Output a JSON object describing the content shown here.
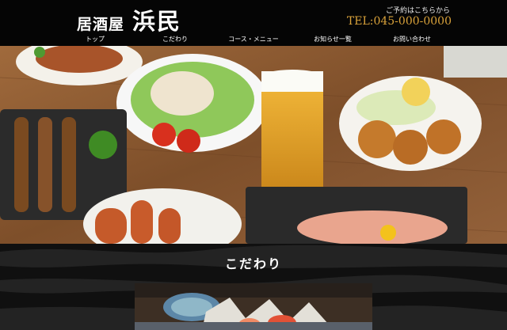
{
  "header": {
    "logo_small": "居酒屋",
    "logo_large": "浜民",
    "reservation_label": "ご予約はこちらから",
    "tel": "TEL:045-000-0000"
  },
  "nav": {
    "items": [
      {
        "label": "トップ"
      },
      {
        "label": "こだわり"
      },
      {
        "label": "コース・メニュー"
      },
      {
        "label": "お知らせ一覧"
      },
      {
        "label": "お問い合わせ"
      }
    ]
  },
  "hero": {
    "image_icon": "food-photo-image"
  },
  "section": {
    "title": "こだわり",
    "image_icon": "sashimi-photo-image"
  },
  "colors": {
    "header_bg": "#050505",
    "tel": "#d9a23a",
    "section_bg": "#111111"
  }
}
